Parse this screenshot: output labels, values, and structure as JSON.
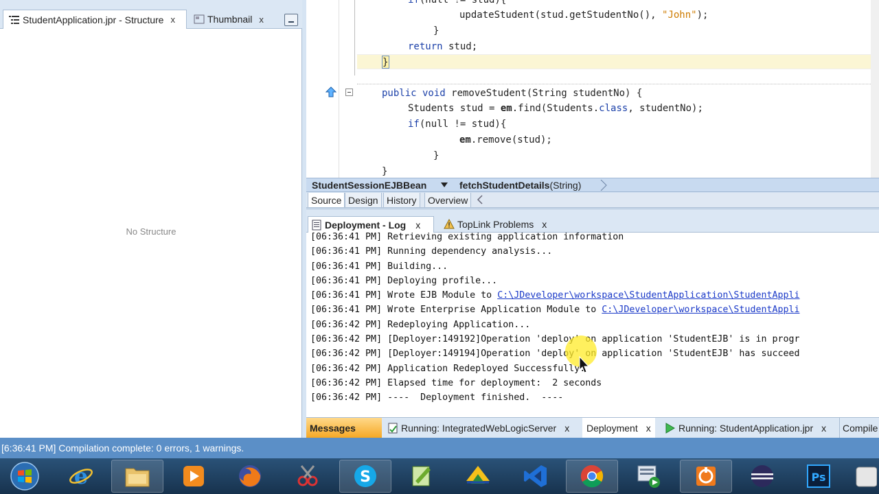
{
  "left_panel": {
    "tabs": [
      {
        "label": "StudentApplication.jpr - Structure",
        "close": "x"
      },
      {
        "label": "Thumbnail",
        "close": "x"
      }
    ],
    "empty_text": "No Structure"
  },
  "editor": {
    "lines": [
      {
        "parts": [
          {
            "t": "if",
            "c": "kw"
          },
          {
            "t": "(null != stud){",
            "c": ""
          }
        ]
      },
      {
        "parts": [
          {
            "t": "updateStudent(stud.getStudentNo(), ",
            "c": ""
          },
          {
            "t": "\"John\"",
            "c": "str"
          },
          {
            "t": ");",
            "c": ""
          }
        ]
      },
      {
        "parts": [
          {
            "t": "}",
            "c": ""
          }
        ]
      },
      {
        "parts": [
          {
            "t": "return",
            "c": "kw"
          },
          {
            "t": " stud;",
            "c": ""
          }
        ]
      },
      {
        "parts": [
          {
            "t": "}",
            "c": ""
          }
        ]
      },
      {
        "parts": [
          {
            "t": "public void",
            "c": "kw"
          },
          {
            "t": " removeStudent(String studentNo) {",
            "c": ""
          }
        ]
      },
      {
        "parts": [
          {
            "t": "Students stud = ",
            "c": ""
          },
          {
            "t": "em",
            "c": "bold"
          },
          {
            "t": ".find(Students.",
            "c": ""
          },
          {
            "t": "class",
            "c": "kw"
          },
          {
            "t": ", studentNo);",
            "c": ""
          }
        ]
      },
      {
        "parts": [
          {
            "t": "if",
            "c": "kw"
          },
          {
            "t": "(null != stud){",
            "c": ""
          }
        ]
      },
      {
        "parts": [
          {
            "t": "em",
            "c": "bold"
          },
          {
            "t": ".remove(stud);",
            "c": ""
          }
        ]
      },
      {
        "parts": [
          {
            "t": "}",
            "c": ""
          }
        ]
      },
      {
        "parts": [
          {
            "t": "}",
            "c": ""
          }
        ]
      }
    ]
  },
  "breadcrumb": {
    "class_name": "StudentSessionEJBBean",
    "method_name": "fetchStudentDetails",
    "method_params": "(String)"
  },
  "source_tabs": [
    "Source",
    "Design",
    "History",
    "Overview"
  ],
  "log_panel": {
    "tabs": [
      {
        "label": "Deployment - Log",
        "close": "x"
      },
      {
        "label": "TopLink Problems",
        "close": "x"
      }
    ],
    "lines": [
      {
        "text": "[06:36:41 PM] Retrieving existing application information",
        "link": ""
      },
      {
        "text": "[06:36:41 PM] Running dependency analysis...",
        "link": ""
      },
      {
        "text": "[06:36:41 PM] Building...",
        "link": ""
      },
      {
        "text": "[06:36:41 PM] Deploying profile...",
        "link": ""
      },
      {
        "text": "[06:36:41 PM] Wrote EJB Module to ",
        "link": "C:\\JDeveloper\\workspace\\StudentApplication\\StudentAppli"
      },
      {
        "text": "[06:36:41 PM] Wrote Enterprise Application Module to ",
        "link": "C:\\JDeveloper\\workspace\\StudentAppli"
      },
      {
        "text": "[06:36:42 PM] Redeploying Application...",
        "link": ""
      },
      {
        "text": "[06:36:42 PM] [Deployer:149192]Operation 'deploy' on application 'StudentEJB' is in progr",
        "link": ""
      },
      {
        "text": "[06:36:42 PM] [Deployer:149194]Operation 'deploy' on application 'StudentEJB' has succeed",
        "link": ""
      },
      {
        "text": "[06:36:42 PM] Application Redeployed Successfully.",
        "link": ""
      },
      {
        "text": "[06:36:42 PM] Elapsed time for deployment:  2 seconds",
        "link": ""
      },
      {
        "text": "[06:36:42 PM] ----  Deployment finished.  ----",
        "link": ""
      }
    ]
  },
  "dock_tabs": [
    {
      "label": "Messages",
      "close": ""
    },
    {
      "label": "Running: IntegratedWebLogicServer",
      "close": "x"
    },
    {
      "label": "Deployment",
      "close": "x"
    },
    {
      "label": "Running: StudentApplication.jpr",
      "close": "x"
    },
    {
      "label": "Compile",
      "close": ""
    }
  ],
  "status_bar": {
    "text": "[6:36:41 PM] Compilation complete: 0 errors, 1 warnings."
  },
  "taskbar": {
    "items": [
      "start-orb-icon",
      "internet-explorer-icon",
      "file-explorer-icon",
      "media-player-icon",
      "firefox-icon",
      "snipping-tool-icon",
      "skype-icon",
      "notepad-plus-icon",
      "pidgin-icon",
      "visual-studio-icon",
      "chrome-icon",
      "screen-recorder-icon",
      "vlc-icon",
      "eclipse-icon",
      "photoshop-icon",
      "app-icon"
    ]
  },
  "colors": {
    "keyword": "#1a3fa8",
    "string": "#ce7b00",
    "link": "#1a39c8",
    "status_bar": "#5b8fc7",
    "messages_tab": "#f6a825"
  }
}
